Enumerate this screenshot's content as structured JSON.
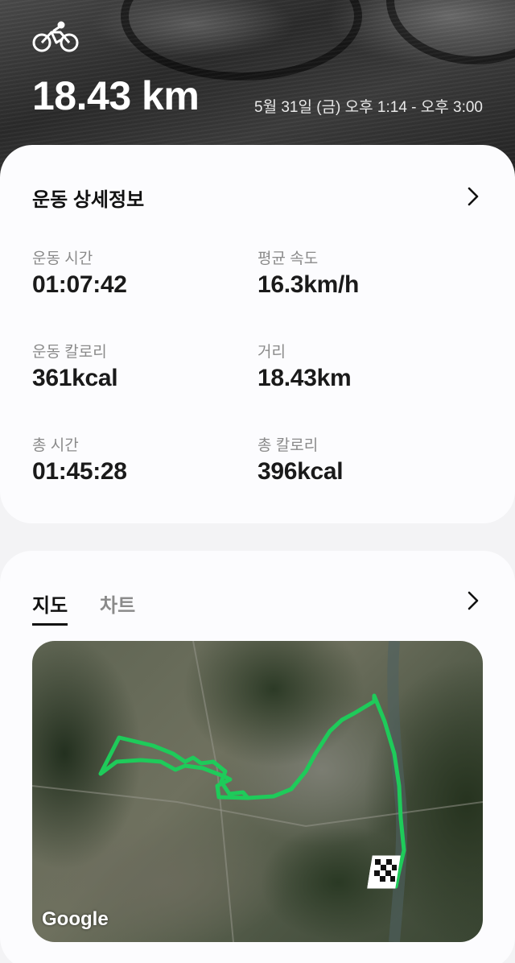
{
  "header": {
    "activity_icon": "bicycle-icon",
    "distance": "18.43 km",
    "datetime": "5월 31일 (금) 오후 1:14 - 오후 3:00"
  },
  "details": {
    "title": "운동 상세정보",
    "stats": [
      {
        "label": "운동 시간",
        "value": "01:07:42"
      },
      {
        "label": "평균 속도",
        "value": "16.3km/h"
      },
      {
        "label": "운동 칼로리",
        "value": "361kcal"
      },
      {
        "label": "거리",
        "value": "18.43km"
      },
      {
        "label": "총 시간",
        "value": "01:45:28"
      },
      {
        "label": "총 칼로리",
        "value": "396kcal"
      }
    ]
  },
  "map_card": {
    "tabs": [
      {
        "label": "지도",
        "active": true
      },
      {
        "label": "차트",
        "active": false
      }
    ],
    "map_attribution": "Google",
    "route_color": "#1ecb5a",
    "finish_icon": "checkered-flag-icon"
  }
}
